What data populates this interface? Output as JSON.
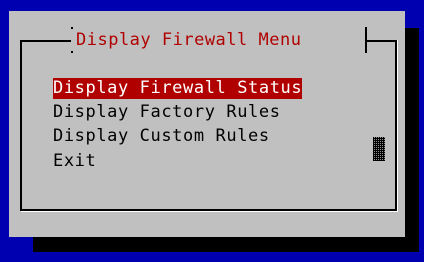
{
  "dialog": {
    "title": "Display Firewall Menu",
    "items": [
      {
        "label": "Display Firewall Status",
        "selected": true
      },
      {
        "label": "Display Factory Rules",
        "selected": false
      },
      {
        "label": "Display Custom Rules",
        "selected": false
      },
      {
        "label": "Exit",
        "selected": false
      }
    ]
  },
  "colors": {
    "background": "#0000b0",
    "dialog": "#c0c0c0",
    "title": "#b00000",
    "highlight": "#b00000",
    "text": "#000000",
    "shadow": "#000000"
  }
}
